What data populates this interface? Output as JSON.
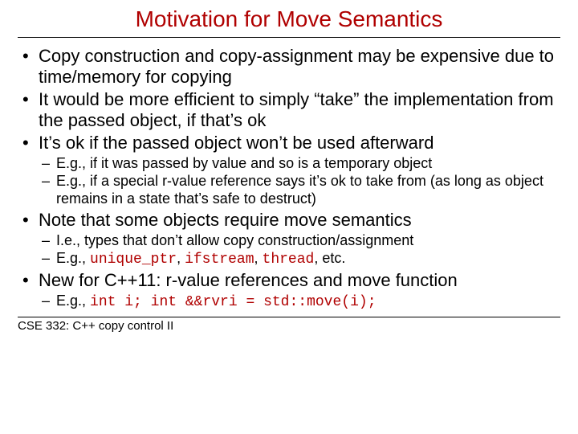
{
  "title": "Motivation for Move Semantics",
  "bullets": [
    {
      "text": "Copy construction and copy-assignment may be expensive due to time/memory for copying"
    },
    {
      "text": "It would be more efficient to simply “take” the implementation from the passed object, if that’s ok"
    },
    {
      "text": "It’s ok if the passed object won’t be used afterward",
      "sub": [
        {
          "text": "E.g., if it was passed by value and so is a temporary object"
        },
        {
          "text": "E.g., if a special r-value reference says it’s ok to take from (as long as object remains in a state that’s safe to destruct)"
        }
      ]
    },
    {
      "text": "Note that some objects require move semantics",
      "sub": [
        {
          "text": "I.e., types that don’t allow copy construction/assignment"
        },
        {
          "prefix": "E.g., ",
          "codes": [
            "unique_ptr",
            "ifstream",
            "thread"
          ],
          "suffix": ", etc."
        }
      ]
    },
    {
      "text": "New for C++11: r-value references and move function",
      "sub": [
        {
          "prefix": "E.g., ",
          "code": "int i; int &&rvri = std::move(i);"
        }
      ]
    }
  ],
  "footer": "CSE 332: C++ copy control II"
}
